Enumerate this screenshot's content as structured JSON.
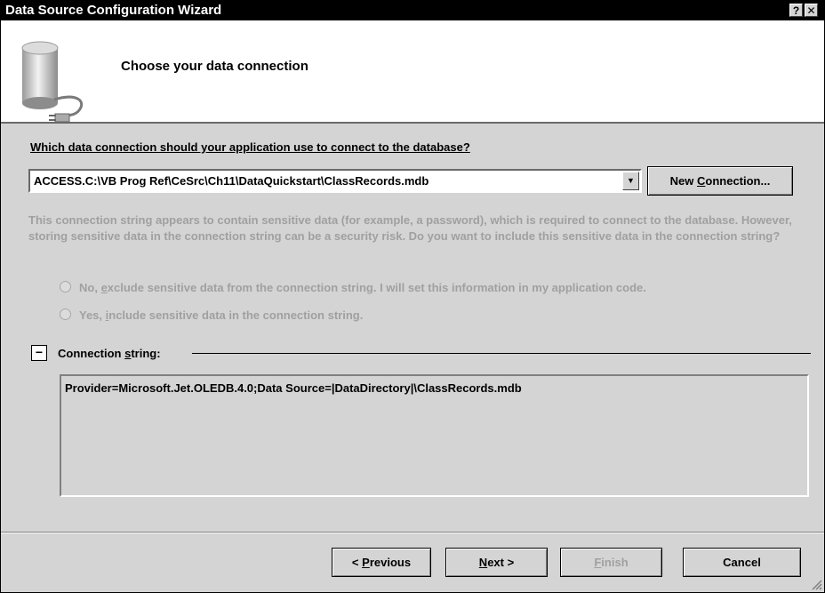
{
  "window": {
    "title": "Data Source Configuration Wizard",
    "help_label": "?",
    "close_label": "✕"
  },
  "header": {
    "title": "Choose your data connection",
    "icon": "database-plug-icon"
  },
  "connection": {
    "question": "Which data connection should your application use to connect to the database?",
    "selected": "ACCESS.C:\\VB Prog Ref\\CeSrc\\Ch11\\DataQuickstart\\ClassRecords.mdb",
    "new_connection": {
      "pre": "New ",
      "key": "C",
      "post": "onnection..."
    }
  },
  "sensitive": {
    "text": "This connection string appears to contain sensitive data (for example, a password), which is required to connect to the database. However, storing sensitive data in the connection string can be a security risk. Do you want to include this sensitive data in the connection string?",
    "option_no": {
      "pre": "No, ",
      "key": "e",
      "post": "xclude sensitive data from the connection string. I will set this information in my application code."
    },
    "option_yes": {
      "pre": "Yes, ",
      "key": "i",
      "post": "nclude sensitive data in the connection string."
    }
  },
  "conn_string": {
    "toggle": "−",
    "label": {
      "pre": "Connection ",
      "key": "s",
      "post": "tring:"
    },
    "value": "Provider=Microsoft.Jet.OLEDB.4.0;Data Source=|DataDirectory|\\ClassRecords.mdb"
  },
  "footer": {
    "previous": {
      "pre": "< ",
      "key": "P",
      "post": "revious"
    },
    "next": {
      "pre": "",
      "key": "N",
      "post": "ext >"
    },
    "finish": {
      "pre": "",
      "key": "F",
      "post": "inish"
    },
    "cancel": "Cancel"
  }
}
